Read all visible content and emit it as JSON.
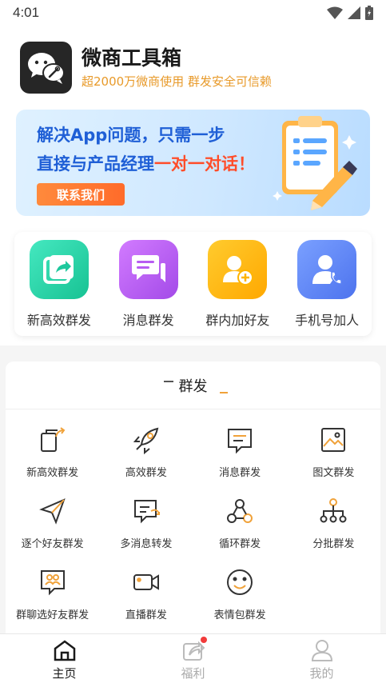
{
  "status": {
    "time": "4:01"
  },
  "header": {
    "title": "微商工具箱",
    "subtitle": "超2000万微商使用 群发安全可信赖"
  },
  "banner": {
    "line1": "解决App问题，只需一步",
    "line2_a": "直接与产品经理",
    "line2_b": "一对一对话！",
    "button": "联系我们"
  },
  "quick_actions": [
    {
      "label": "新高效群发",
      "color": "#2bd1a8"
    },
    {
      "label": "消息群发",
      "color": "#b75cf2"
    },
    {
      "label": "群内加好友",
      "color": "#ffb400"
    },
    {
      "label": "手机号加人",
      "color": "#5a82f5"
    }
  ],
  "section": {
    "title": "群发",
    "tools": [
      "新高效群发",
      "高效群发",
      "消息群发",
      "图文群发",
      "逐个好友群发",
      "多消息转发",
      "循环群发",
      "分批群发",
      "群聊选好友群发",
      "直播群发",
      "表情包群发"
    ]
  },
  "nav": {
    "items": [
      {
        "label": "主页",
        "active": true
      },
      {
        "label": "福利",
        "active": false,
        "badge": true
      },
      {
        "label": "我的",
        "active": false
      }
    ]
  },
  "colors": {
    "accent": "#f0a23a",
    "active": "#1a1a1a",
    "inactive": "#aaaaaa"
  }
}
